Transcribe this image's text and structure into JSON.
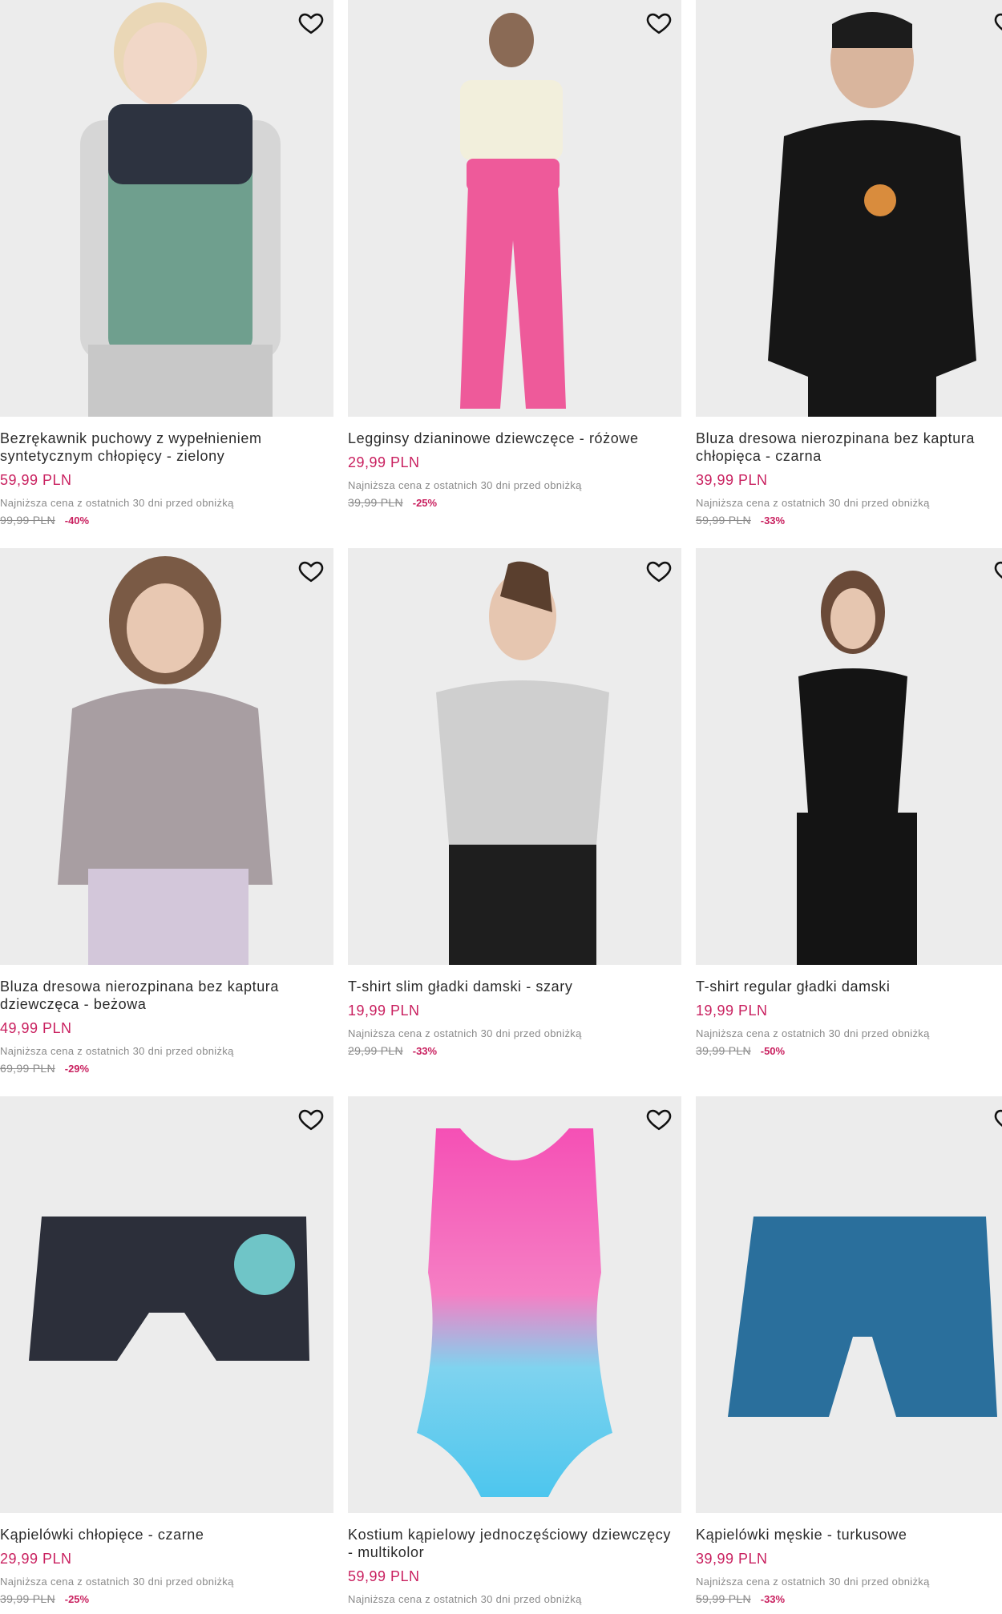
{
  "lowest_label": "Najniższa cena z ostatnich 30 dni przed obniżką",
  "products": [
    {
      "name": "Bezrękawnik puchowy z wypełnieniem syntetycznym chłopięcy - zielony",
      "price": "59,99 PLN",
      "old_price": "99,99 PLN",
      "discount": "-40%"
    },
    {
      "name": "Legginsy dzianinowe dziewczęce - różowe",
      "price": "29,99 PLN",
      "old_price": "39,99 PLN",
      "discount": "-25%"
    },
    {
      "name": "Bluza dresowa nierozpinana bez kaptura chłopięca - czarna",
      "price": "39,99 PLN",
      "old_price": "59,99 PLN",
      "discount": "-33%"
    },
    {
      "name": "Bluza dresowa nierozpinana bez kaptura dziewczęca - beżowa",
      "price": "49,99 PLN",
      "old_price": "69,99 PLN",
      "discount": "-29%"
    },
    {
      "name": "T-shirt slim gładki damski - szary",
      "price": "19,99 PLN",
      "old_price": "29,99 PLN",
      "discount": "-33%"
    },
    {
      "name": "T-shirt regular gładki damski",
      "price": "19,99 PLN",
      "old_price": "39,99 PLN",
      "discount": "-50%"
    },
    {
      "name": "Kąpielówki chłopięce - czarne",
      "price": "29,99 PLN",
      "old_price": "39,99 PLN",
      "discount": "-25%"
    },
    {
      "name": "Kostium kąpielowy jednoczęściowy dziewczęcy - multikolor",
      "price": "59,99 PLN",
      "old_price": "",
      "discount": ""
    },
    {
      "name": "Kąpielówki męskie - turkusowe",
      "price": "39,99 PLN",
      "old_price": "59,99 PLN",
      "discount": "-33%"
    }
  ],
  "colors": {
    "price": "#c9205f",
    "image_bg": "#ececec"
  },
  "icons": {
    "favorite": "heart-outline-icon"
  }
}
